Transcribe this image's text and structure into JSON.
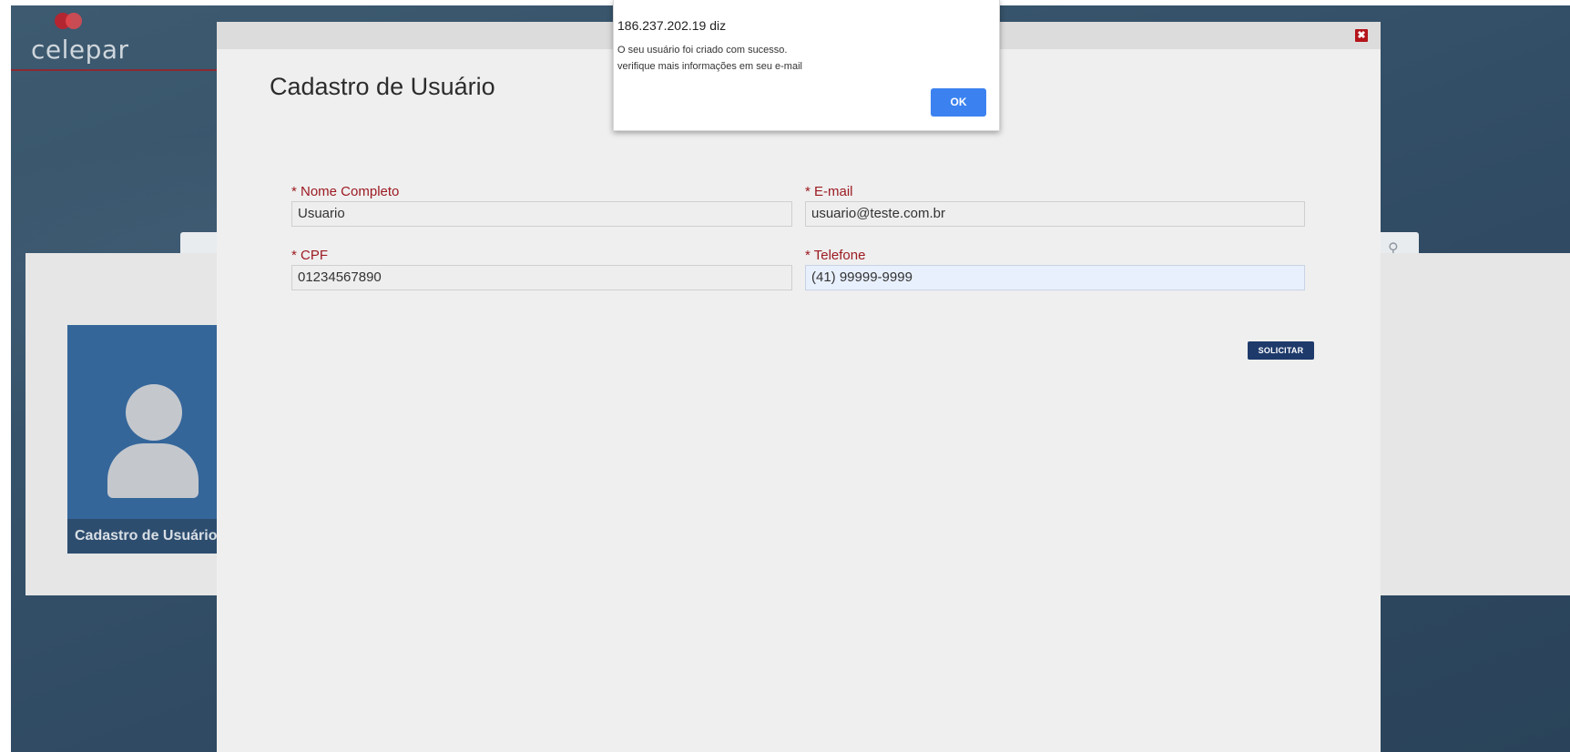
{
  "background": {
    "logo_text": "celepar",
    "card_label": "Cadastro de Usuário"
  },
  "modal": {
    "title": "Cadastro de Usuário",
    "close_label": "✖",
    "fields": {
      "nome": {
        "label": "* Nome Completo",
        "value": "Usuario"
      },
      "email": {
        "label": "* E-mail",
        "value": "usuario@teste.com.br"
      },
      "cpf": {
        "label": "* CPF",
        "value": "01234567890"
      },
      "telefone": {
        "label": "* Telefone",
        "value": "(41) 99999-9999"
      }
    },
    "submit_label": "SOLICITAR"
  },
  "alert": {
    "origin": "186.237.202.19 diz",
    "message_line1": "O seu usuário foi criado com sucesso.",
    "message_line2": "verifique mais informações em seu e-mail",
    "ok_label": "OK"
  },
  "colors": {
    "label_red": "#9c1b22",
    "button_navy": "#1e3a6b",
    "ok_blue": "#3b82f0",
    "close_red": "#b3151b"
  },
  "icons": {
    "search": "search-icon",
    "close": "close-icon",
    "user": "user-icon"
  }
}
